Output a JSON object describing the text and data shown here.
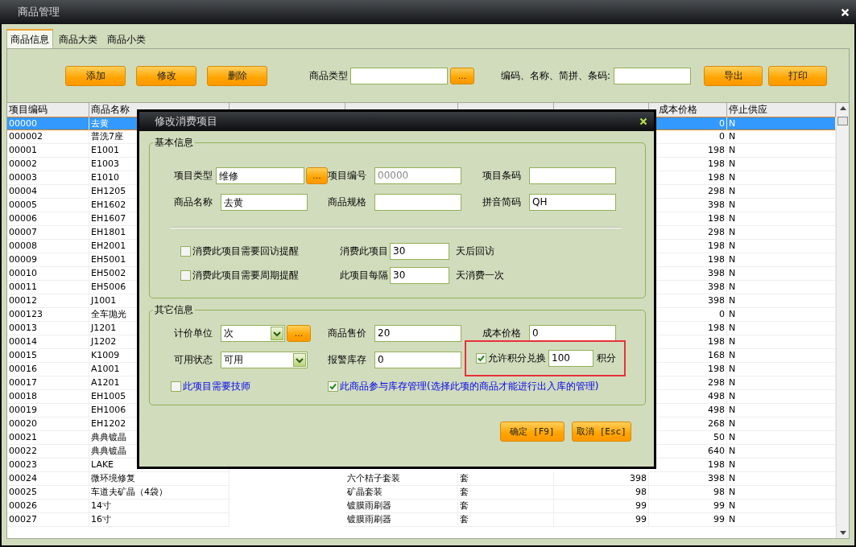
{
  "window": {
    "title": "商品管理"
  },
  "tabs": [
    {
      "label": "商品信息",
      "selected": true
    },
    {
      "label": "商品大类",
      "selected": false
    },
    {
      "label": "商品小类",
      "selected": false
    }
  ],
  "toolbar": {
    "buttons": [
      "添加",
      "修改",
      "删除"
    ],
    "type_label": "商品类型",
    "type_browse": "...",
    "search_label": "编码、名称、简拼、条码:",
    "actions": [
      "导出",
      "打印"
    ]
  },
  "table": {
    "columns": [
      "项目编码",
      "商品名称",
      "成本价格",
      "停止供应"
    ],
    "rows": [
      {
        "code": "00000",
        "name": "去黄",
        "cost_price": "0",
        "stop_supply": "N",
        "selected": true
      },
      {
        "code": "000002",
        "name": "普洗7座",
        "cost_price": "0",
        "stop_supply": "N",
        "selected": false
      },
      {
        "code": "00001",
        "name": "E1001",
        "cost_price": "198",
        "stop_supply": "N",
        "selected": false
      },
      {
        "code": "00002",
        "name": "E1003",
        "cost_price": "198",
        "stop_supply": "N",
        "selected": false
      },
      {
        "code": "00003",
        "name": "E1010",
        "cost_price": "198",
        "stop_supply": "N",
        "selected": false
      },
      {
        "code": "00004",
        "name": "EH1205",
        "cost_price": "298",
        "stop_supply": "N",
        "selected": false
      },
      {
        "code": "00005",
        "name": "EH1602",
        "cost_price": "398",
        "stop_supply": "N",
        "selected": false
      },
      {
        "code": "00006",
        "name": "EH1607",
        "cost_price": "198",
        "stop_supply": "N",
        "selected": false
      },
      {
        "code": "00007",
        "name": "EH1801",
        "cost_price": "298",
        "stop_supply": "N",
        "selected": false
      },
      {
        "code": "00008",
        "name": "EH2001",
        "cost_price": "198",
        "stop_supply": "N",
        "selected": false
      },
      {
        "code": "00009",
        "name": "EH5001",
        "cost_price": "198",
        "stop_supply": "N",
        "selected": false
      },
      {
        "code": "00010",
        "name": "EH5002",
        "cost_price": "398",
        "stop_supply": "N",
        "selected": false
      },
      {
        "code": "00011",
        "name": "EH5006",
        "cost_price": "398",
        "stop_supply": "N",
        "selected": false
      },
      {
        "code": "00012",
        "name": "J1001",
        "cost_price": "398",
        "stop_supply": "N",
        "selected": false
      },
      {
        "code": "000123",
        "name": "全车抛光",
        "cost_price": "0",
        "stop_supply": "N",
        "selected": false
      },
      {
        "code": "00013",
        "name": "J1201",
        "cost_price": "198",
        "stop_supply": "N",
        "selected": false
      },
      {
        "code": "00014",
        "name": "J1202",
        "cost_price": "198",
        "stop_supply": "N",
        "selected": false
      },
      {
        "code": "00015",
        "name": "K1009",
        "cost_price": "168",
        "stop_supply": "N",
        "selected": false
      },
      {
        "code": "00016",
        "name": "A1001",
        "cost_price": "198",
        "stop_supply": "N",
        "selected": false
      },
      {
        "code": "00017",
        "name": "A1201",
        "cost_price": "298",
        "stop_supply": "N",
        "selected": false
      },
      {
        "code": "00018",
        "name": "EH1005",
        "cost_price": "498",
        "stop_supply": "N",
        "selected": false
      },
      {
        "code": "00019",
        "name": "EH1006",
        "cost_price": "498",
        "stop_supply": "N",
        "selected": false
      },
      {
        "code": "00020",
        "name": "EH1202",
        "cost_price": "268",
        "stop_supply": "N",
        "selected": false
      },
      {
        "code": "00021",
        "name": "典典镀晶",
        "cost_price": "50",
        "stop_supply": "N",
        "selected": false
      },
      {
        "code": "00022",
        "name": "典典镀晶",
        "cost_price": "640",
        "stop_supply": "N",
        "selected": false
      },
      {
        "code": "00023",
        "name": "LAKE",
        "cost_price": "198",
        "stop_supply": "N",
        "selected": false
      },
      {
        "code": "00024",
        "name": "微环境修复",
        "subcategory": "六个桔子套装",
        "unit": "套",
        "sale_price": "398",
        "cost_price": "398",
        "stop_supply": "N",
        "selected": false
      },
      {
        "code": "00025",
        "name": "车道夫矿晶（4袋）",
        "subcategory": "矿晶套装",
        "unit": "套",
        "sale_price": "98",
        "cost_price": "98",
        "stop_supply": "N",
        "selected": false
      },
      {
        "code": "00026",
        "name": "14寸",
        "subcategory": "镀膜雨刷器",
        "unit": "套",
        "sale_price": "99",
        "cost_price": "99",
        "stop_supply": "N",
        "selected": false
      },
      {
        "code": "00027",
        "name": "16寸",
        "subcategory": "镀膜雨刷器",
        "unit": "套",
        "sale_price": "99",
        "cost_price": "99",
        "stop_supply": "N",
        "selected": false
      }
    ]
  },
  "dialog": {
    "title": "修改消费项目",
    "basic": {
      "legend": "基本信息",
      "fields": [
        {
          "kind": "browse",
          "label": "项目类型",
          "value": "维修",
          "browse": "..."
        },
        {
          "kind": "readonly",
          "label": "项目编号",
          "value": "00000"
        },
        {
          "kind": "text",
          "label": "项目条码"
        },
        {
          "kind": "text",
          "label": "商品名称",
          "value": "去黄"
        },
        {
          "kind": "text",
          "label": "商品规格"
        },
        {
          "kind": "text",
          "label": "拼音简码",
          "value": "QH"
        }
      ],
      "reminders": [
        {
          "label": "消费此项目需要回访提醒",
          "checked": false,
          "field_label": "消费此项目",
          "value": "30",
          "suffix": "天后回访"
        },
        {
          "label": "消费此项目需要周期提醒",
          "checked": false,
          "field_label": "此项目每隔",
          "value": "30",
          "suffix": "天消费一次"
        }
      ]
    },
    "other": {
      "legend": "其它信息",
      "fields": [
        {
          "kind": "combo-browse",
          "label": "计价单位",
          "value": "次",
          "browse": "..."
        },
        {
          "kind": "text",
          "label": "商品售价",
          "value": "20"
        },
        {
          "kind": "text",
          "label": "成本价格",
          "value": "0"
        },
        {
          "kind": "combo",
          "label": "可用状态",
          "value": "可用"
        },
        {
          "kind": "text",
          "label": "报警库存",
          "value": "0"
        },
        {
          "kind": "points",
          "label": "允许积分兑换",
          "checked": true,
          "value": "100",
          "suffix": "积分",
          "highlighted": true
        }
      ],
      "options": [
        {
          "label": "此项目需要技师",
          "checked": false
        },
        {
          "label": "此商品参与库存管理(选择此项的商品才能进行出入库的管理)",
          "checked": true
        }
      ]
    },
    "buttons": [
      "确定 [F9]",
      "取消 [Esc]"
    ]
  }
}
